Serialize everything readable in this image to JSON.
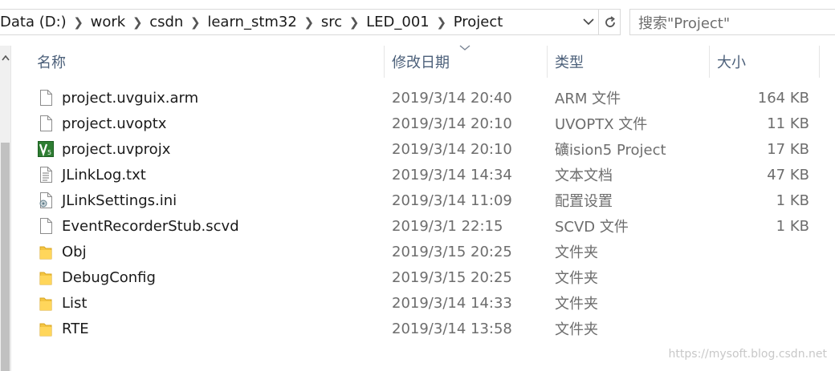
{
  "address": {
    "crumbs": [
      "Data (D:)",
      "work",
      "csdn",
      "learn_stm32",
      "src",
      "LED_001",
      "Project"
    ]
  },
  "search": {
    "placeholder": "搜索\"Project\""
  },
  "columns": {
    "name": "名称",
    "date": "修改日期",
    "type": "类型",
    "size": "大小"
  },
  "files": [
    {
      "name": "project.uvguix.arm",
      "date": "2019/3/14 20:40",
      "type": "ARM 文件",
      "size": "164 KB",
      "icon": "file-icon"
    },
    {
      "name": "project.uvoptx",
      "date": "2019/3/14 20:10",
      "type": "UVOPTX 文件",
      "size": "11 KB",
      "icon": "file-icon"
    },
    {
      "name": "project.uvprojx",
      "date": "2019/3/14 20:10",
      "type": "礦ision5 Project",
      "size": "17 KB",
      "icon": "keil-project-icon"
    },
    {
      "name": "JLinkLog.txt",
      "date": "2019/3/14 14:34",
      "type": "文本文档",
      "size": "47 KB",
      "icon": "text-file-icon"
    },
    {
      "name": "JLinkSettings.ini",
      "date": "2019/3/14 11:09",
      "type": "配置设置",
      "size": "1 KB",
      "icon": "settings-file-icon"
    },
    {
      "name": "EventRecorderStub.scvd",
      "date": "2019/3/1 22:15",
      "type": "SCVD 文件",
      "size": "1 KB",
      "icon": "file-icon"
    },
    {
      "name": "Obj",
      "date": "2019/3/15 20:25",
      "type": "文件夹",
      "size": "",
      "icon": "folder-icon"
    },
    {
      "name": "DebugConfig",
      "date": "2019/3/15 20:25",
      "type": "文件夹",
      "size": "",
      "icon": "folder-icon"
    },
    {
      "name": "List",
      "date": "2019/3/14 14:33",
      "type": "文件夹",
      "size": "",
      "icon": "folder-icon"
    },
    {
      "name": "RTE",
      "date": "2019/3/14 13:58",
      "type": "文件夹",
      "size": "",
      "icon": "folder-icon"
    }
  ],
  "watermark": "https://mysoft.blog.csdn.net"
}
